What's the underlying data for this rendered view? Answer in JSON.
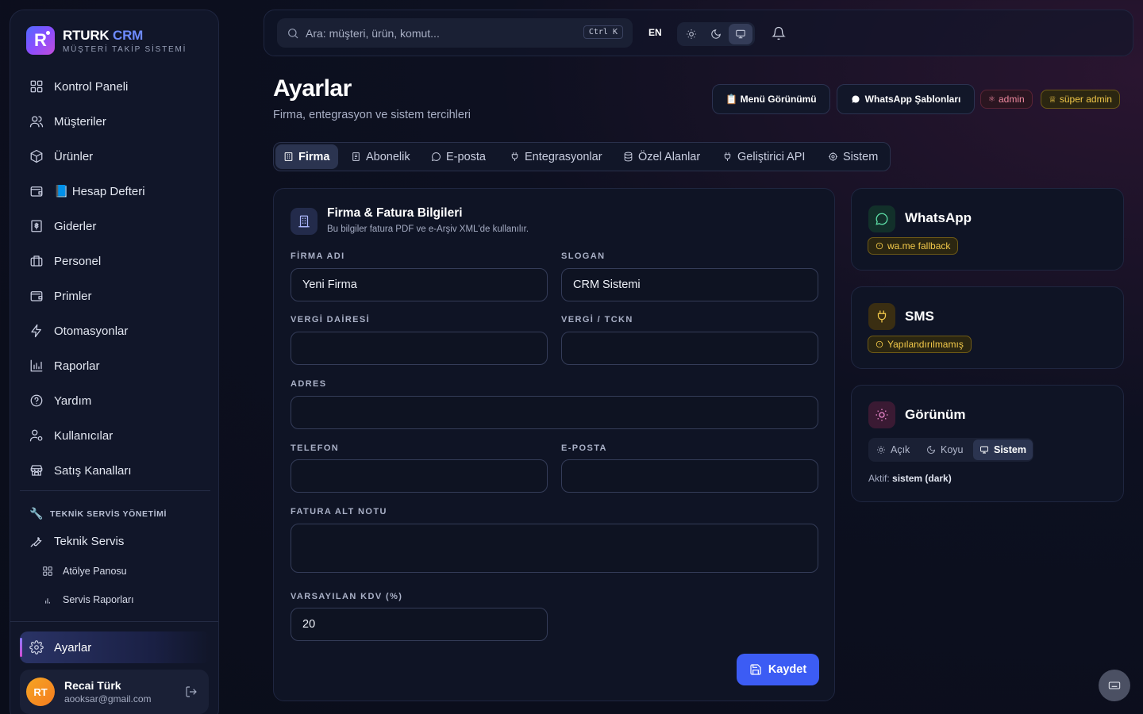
{
  "brand": {
    "name_a": "RTURK",
    "name_b": "CRM",
    "subtitle": "MÜŞTERİ TAKİP SİSTEMİ",
    "logo_letter": "R"
  },
  "sidebar": {
    "items": [
      {
        "label": "Kontrol Paneli",
        "icon": "grid-icon"
      },
      {
        "label": "Müşteriler",
        "icon": "users-icon"
      },
      {
        "label": "Ürünler",
        "icon": "box-icon"
      },
      {
        "label": "📘 Hesap Defteri",
        "icon": "wallet-icon"
      },
      {
        "label": "Giderler",
        "icon": "receipt-icon"
      },
      {
        "label": "Personel",
        "icon": "briefcase-icon"
      },
      {
        "label": "Primler",
        "icon": "wallet-icon"
      },
      {
        "label": "Otomasyonlar",
        "icon": "bolt-icon"
      },
      {
        "label": "Raporlar",
        "icon": "bar-chart-icon"
      },
      {
        "label": "Yardım",
        "icon": "help-icon"
      },
      {
        "label": "Kullanıcılar",
        "icon": "user-cog-icon"
      },
      {
        "label": "Satış Kanalları",
        "icon": "store-icon"
      }
    ],
    "section_title": "TEKNİK SERVİS YÖNETİMİ",
    "service_item": "Teknik Servis",
    "sub_items": [
      {
        "label": "Atölye Panosu",
        "icon": "grid-icon"
      },
      {
        "label": "Servis Raporları",
        "icon": "bar-chart-icon"
      }
    ],
    "settings": "Ayarlar",
    "user": {
      "initials": "RT",
      "name": "Recai Türk",
      "email": "aooksar@gmail.com"
    }
  },
  "topbar": {
    "search_placeholder": "Ara: müşteri, ürün, komut...",
    "shortcut": "Ctrl K",
    "language": "EN"
  },
  "header": {
    "title": "Ayarlar",
    "subtitle": "Firma, entegrasyon ve sistem tercihleri",
    "menu_button": "📋 Menü Görünümü",
    "whatsapp_button": "WhatsApp Şablonları",
    "role_admin": "admin",
    "role_super": "süper admin"
  },
  "tabs": [
    {
      "label": "Firma",
      "active": true
    },
    {
      "label": "Abonelik"
    },
    {
      "label": "E-posta"
    },
    {
      "label": "Entegrasyonlar"
    },
    {
      "label": "Özel Alanlar"
    },
    {
      "label": "Geliştirici API"
    },
    {
      "label": "Sistem"
    }
  ],
  "company_card": {
    "title": "Firma & Fatura Bilgileri",
    "description": "Bu bilgiler fatura PDF ve e-Arşiv XML'de kullanılır.",
    "fields": {
      "firma_adi": {
        "label": "FİRMA ADI",
        "value": "Yeni Firma"
      },
      "slogan": {
        "label": "SLOGAN",
        "value": "CRM Sistemi"
      },
      "vergi_dairesi": {
        "label": "VERGİ DAİRESİ",
        "value": ""
      },
      "vergi_tckn": {
        "label": "VERGİ / TCKN",
        "value": ""
      },
      "adres": {
        "label": "ADRES",
        "value": ""
      },
      "telefon": {
        "label": "TELEFON",
        "value": ""
      },
      "eposta": {
        "label": "E-POSTA",
        "value": ""
      },
      "fatura_alt_notu": {
        "label": "FATURA ALT NOTU",
        "value": ""
      },
      "kdv": {
        "label": "VARSAYILAN KDV (%)",
        "value": "20"
      }
    },
    "save_label": "Kaydet"
  },
  "side_cards": {
    "whatsapp": {
      "title": "WhatsApp",
      "badge": "wa.me fallback"
    },
    "sms": {
      "title": "SMS",
      "badge": "Yapılandırılmamış"
    },
    "appearance": {
      "title": "Görünüm",
      "options": [
        "Açık",
        "Koyu",
        "Sistem"
      ],
      "active_prefix": "Aktif:",
      "active_value": "sistem (dark)"
    }
  },
  "colors": {
    "accent": "#3c5cf4",
    "warning": "#f3c94a",
    "admin_badge": "#f08aa0",
    "super_badge": "#f3c94a"
  }
}
